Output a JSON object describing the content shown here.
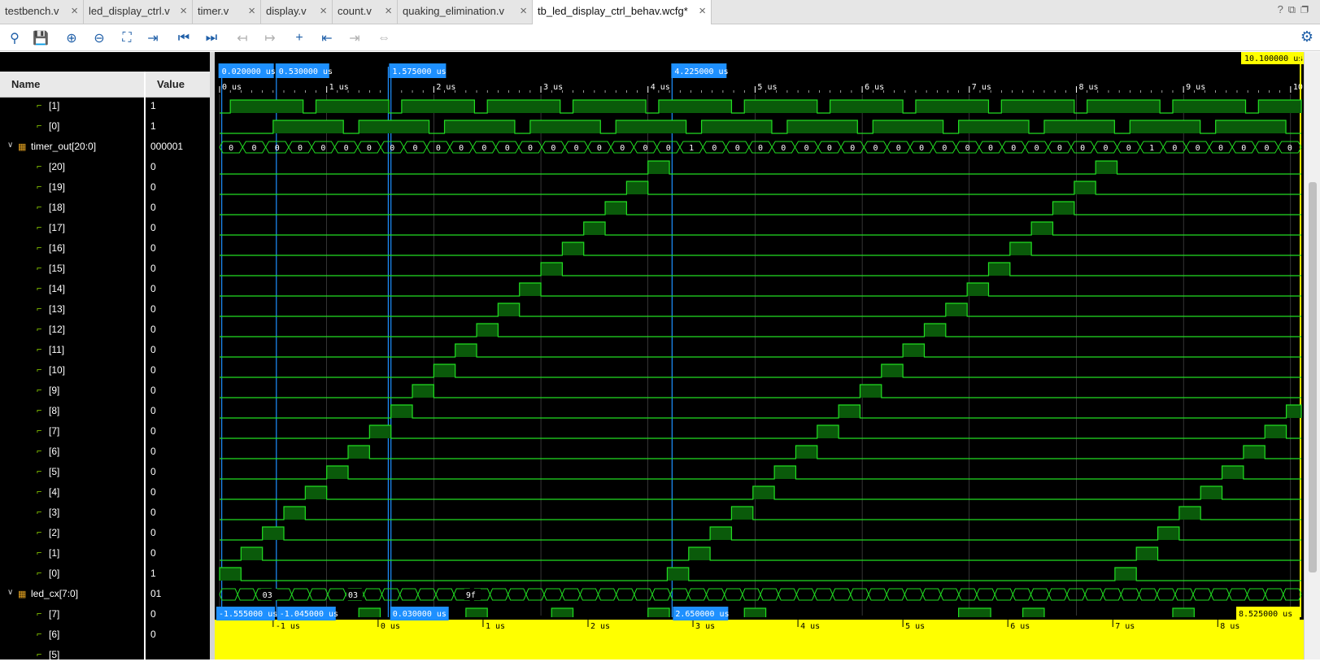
{
  "tabs": [
    {
      "label": "testbench.v",
      "active": false
    },
    {
      "label": "led_display_ctrl.v",
      "active": false
    },
    {
      "label": "timer.v",
      "active": false
    },
    {
      "label": "display.v",
      "active": false
    },
    {
      "label": "count.v",
      "active": false
    },
    {
      "label": "quaking_elimination.v",
      "active": false
    },
    {
      "label": "tb_led_display_ctrl_behav.wcfg*",
      "active": true
    }
  ],
  "tab_close_glyph": "×",
  "window_actions": [
    "?",
    "⧉",
    "❐"
  ],
  "toolbar": {
    "buttons": [
      {
        "name": "search-icon",
        "glyph": "⚲",
        "enabled": true
      },
      {
        "name": "save-icon",
        "glyph": "💾",
        "enabled": true
      },
      {
        "name": "zoom-in-icon",
        "glyph": "⊕",
        "enabled": true
      },
      {
        "name": "zoom-out-icon",
        "glyph": "⊖",
        "enabled": true
      },
      {
        "name": "zoom-fit-icon",
        "glyph": "⛶",
        "enabled": true
      },
      {
        "name": "go-to-cursor-icon",
        "glyph": "⇥",
        "enabled": true
      },
      {
        "name": "go-to-time-zero-icon",
        "glyph": "⏮",
        "enabled": true
      },
      {
        "name": "go-to-last-time-icon",
        "glyph": "⏭",
        "enabled": true
      },
      {
        "name": "previous-transition-icon",
        "glyph": "↤",
        "enabled": false
      },
      {
        "name": "next-transition-icon",
        "glyph": "↦",
        "enabled": false
      },
      {
        "name": "add-marker-icon",
        "glyph": "+",
        "enabled": true
      },
      {
        "name": "previous-marker-icon",
        "glyph": "⇤",
        "enabled": true
      },
      {
        "name": "next-marker-icon",
        "glyph": "⇥",
        "enabled": false
      },
      {
        "name": "swap-cursors-icon",
        "glyph": "⇔",
        "enabled": false
      }
    ],
    "settings_glyph": "⚙"
  },
  "columns": {
    "name": "Name",
    "value": "Value"
  },
  "signals": [
    {
      "name": "[1]",
      "value": "1",
      "kind": "bit",
      "indent": 2
    },
    {
      "name": "[0]",
      "value": "1",
      "kind": "bit",
      "indent": 2
    },
    {
      "name": "timer_out[20:0]",
      "value": "000001",
      "kind": "bus",
      "indent": 1,
      "expanded": true
    },
    {
      "name": "[20]",
      "value": "0",
      "kind": "bit",
      "indent": 2
    },
    {
      "name": "[19]",
      "value": "0",
      "kind": "bit",
      "indent": 2
    },
    {
      "name": "[18]",
      "value": "0",
      "kind": "bit",
      "indent": 2
    },
    {
      "name": "[17]",
      "value": "0",
      "kind": "bit",
      "indent": 2
    },
    {
      "name": "[16]",
      "value": "0",
      "kind": "bit",
      "indent": 2
    },
    {
      "name": "[15]",
      "value": "0",
      "kind": "bit",
      "indent": 2
    },
    {
      "name": "[14]",
      "value": "0",
      "kind": "bit",
      "indent": 2
    },
    {
      "name": "[13]",
      "value": "0",
      "kind": "bit",
      "indent": 2
    },
    {
      "name": "[12]",
      "value": "0",
      "kind": "bit",
      "indent": 2
    },
    {
      "name": "[11]",
      "value": "0",
      "kind": "bit",
      "indent": 2
    },
    {
      "name": "[10]",
      "value": "0",
      "kind": "bit",
      "indent": 2
    },
    {
      "name": "[9]",
      "value": "0",
      "kind": "bit",
      "indent": 2
    },
    {
      "name": "[8]",
      "value": "0",
      "kind": "bit",
      "indent": 2
    },
    {
      "name": "[7]",
      "value": "0",
      "kind": "bit",
      "indent": 2
    },
    {
      "name": "[6]",
      "value": "0",
      "kind": "bit",
      "indent": 2
    },
    {
      "name": "[5]",
      "value": "0",
      "kind": "bit",
      "indent": 2
    },
    {
      "name": "[4]",
      "value": "0",
      "kind": "bit",
      "indent": 2
    },
    {
      "name": "[3]",
      "value": "0",
      "kind": "bit",
      "indent": 2
    },
    {
      "name": "[2]",
      "value": "0",
      "kind": "bit",
      "indent": 2
    },
    {
      "name": "[1]",
      "value": "0",
      "kind": "bit",
      "indent": 2
    },
    {
      "name": "[0]",
      "value": "1",
      "kind": "bit",
      "indent": 2
    },
    {
      "name": "led_cx[7:0]",
      "value": "01",
      "kind": "bus",
      "indent": 1,
      "expanded": true
    },
    {
      "name": "[7]",
      "value": "0",
      "kind": "bit",
      "indent": 2
    },
    {
      "name": "[6]",
      "value": "0",
      "kind": "bit",
      "indent": 2
    },
    {
      "name": "[5]",
      "value": "",
      "kind": "bit",
      "indent": 2
    }
  ],
  "timeline": {
    "end_label": "10.100000 us",
    "top_ticks": [
      "0 us",
      "1 us",
      "2 us",
      "3 us",
      "4 us",
      "5 us",
      "6 us",
      "7 us",
      "8 us",
      "9 us",
      "10"
    ],
    "top_markers": [
      "0.020000 us",
      "0.530000 us",
      "1.575000 us",
      "4.225000 us"
    ],
    "bottom_ticks": [
      "-1 us",
      "0 us",
      "1 us",
      "2 us",
      "3 us",
      "4 us",
      "5 us",
      "6 us",
      "7 us",
      "8 us"
    ],
    "bottom_markers": [
      "-1.555000 us",
      "-1.045000 us",
      "0.030000 us",
      "2.650000 us",
      "8.525000 us"
    ]
  },
  "bus_values": {
    "timer_out": [
      "0",
      "0",
      "0",
      "0",
      "0",
      "0",
      "0",
      "0",
      "0",
      "0",
      "0",
      "0",
      "0",
      "0",
      "0",
      "0",
      "0",
      "0",
      "0",
      "0",
      "1",
      "0",
      "0",
      "0",
      "0",
      "0",
      "0",
      "0",
      "0",
      "0",
      "0",
      "0",
      "0",
      "0",
      "0",
      "0",
      "0",
      "0",
      "0",
      "0",
      "1",
      "0",
      "0",
      "0",
      "0",
      "0",
      "0"
    ],
    "led_cx": [
      "03",
      "03",
      "9f"
    ]
  },
  "colors": {
    "wave": "#22dd22",
    "wave_fill": "#0a5a0a",
    "marker": "#1e90ff",
    "cursor_yellow": "#ffff00",
    "grid": "#c0c0c0"
  }
}
